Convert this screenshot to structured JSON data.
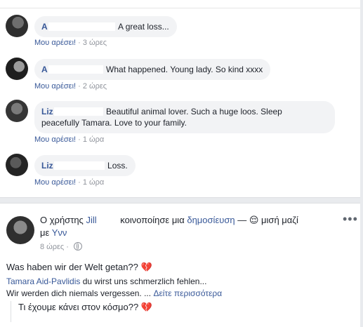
{
  "comments": [
    {
      "name_visible": "Α",
      "name_tail": "",
      "text": "A great loss...",
      "like_label": "Μου αρέσει!",
      "separator": "·",
      "time": "3 ώρες"
    },
    {
      "name_visible": "A",
      "text": "What happened. Young lady. So kind xxxx",
      "like_label": "Μου αρέσει!",
      "separator": "·",
      "time": "2 ώρες"
    },
    {
      "name_visible": "Liz",
      "text_line1": "Beautiful animal lover. Such a huge loos. Sleep",
      "text_line2": "peacefully Tamara. Love to your family.",
      "like_label": "Μου αρέσει!",
      "separator": "·",
      "time": "1 ώρα"
    },
    {
      "name_visible": "Liz",
      "text": "Loss.",
      "like_label": "Μου αρέσει!",
      "separator": "·",
      "time": "1 ώρα"
    }
  ],
  "post": {
    "prefix": "Ο χρήστης",
    "author": "Jill",
    "shared_text": "κοινοποίησε μια",
    "shared_link": "δημοσίευση",
    "dash": "—",
    "feeling": "μισή μαζί",
    "with_prefix": "με",
    "with_name": "Υνν",
    "more_label": "•••",
    "time": "8 ώρες",
    "separator": "·",
    "text": "Was haben wir der Welt getan??",
    "shared_author": "Tamara Aid-Pavlidis",
    "shared_line1": "du wirst uns schmerzlich fehlen...",
    "shared_line2": "Wir werden dich niemals vergessen. ...",
    "see_more": "Δείτε περισσότερα",
    "quoted_text": "Τι έχουμε κάνει στον κόσμο??",
    "heart_emoji": "💔",
    "feeling_emoji": "😌"
  }
}
